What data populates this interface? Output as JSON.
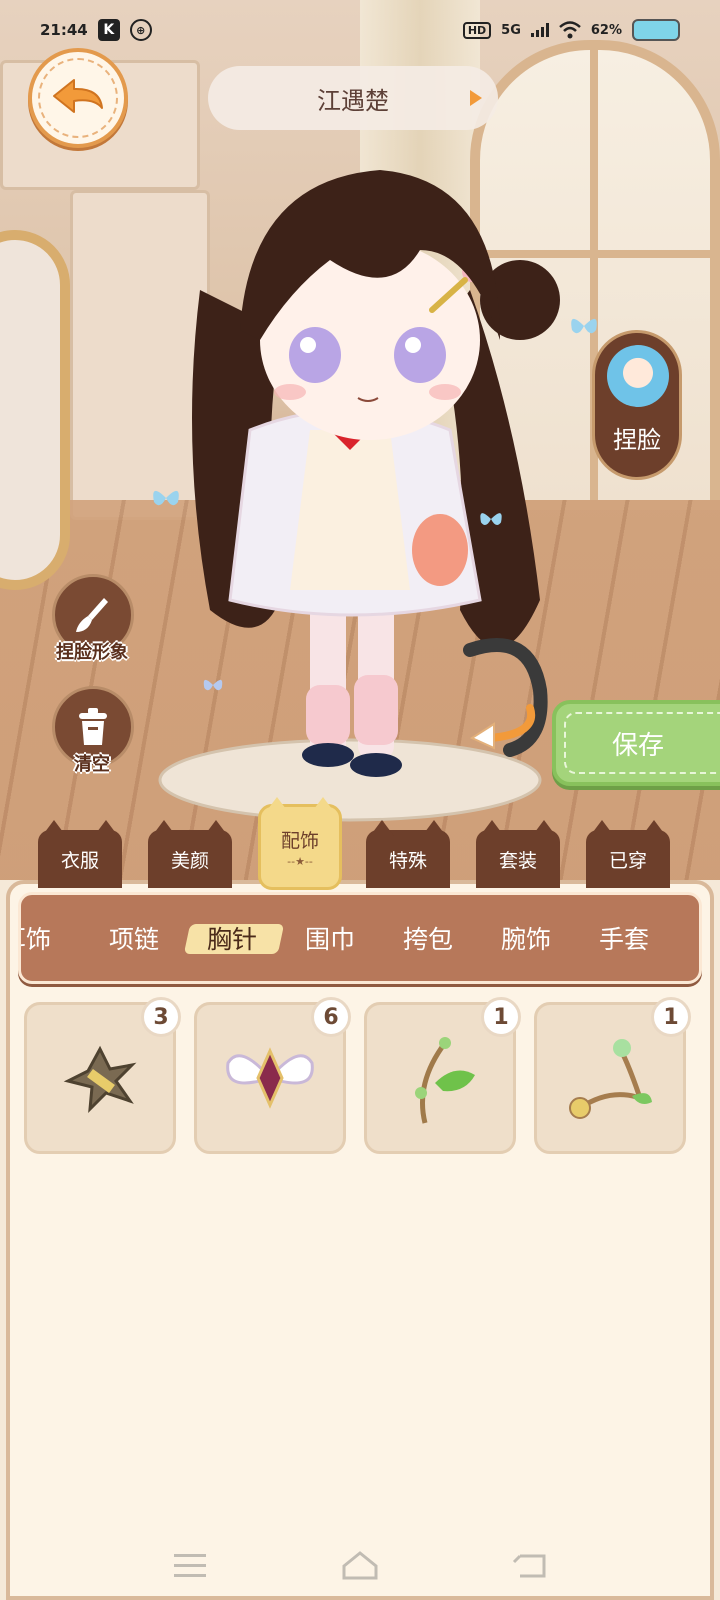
{
  "status_bar": {
    "time": "21:44",
    "k_icon": "K",
    "network": "5G",
    "hd": "HD",
    "battery": "62%"
  },
  "header": {
    "character_name": "江遇楚"
  },
  "side_buttons": {
    "face_edit": "捏脸",
    "face_image": "捏脸形象",
    "clear": "清空",
    "save": "保存"
  },
  "category_tabs": [
    {
      "label": "衣服",
      "active": false
    },
    {
      "label": "美颜",
      "active": false
    },
    {
      "label": "配饰",
      "active": true
    },
    {
      "label": "特殊",
      "active": false
    },
    {
      "label": "套装",
      "active": false
    },
    {
      "label": "已穿",
      "active": false
    }
  ],
  "sub_tabs": [
    {
      "label": "耳饰",
      "active": false
    },
    {
      "label": "项链",
      "active": false
    },
    {
      "label": "胸针",
      "active": true
    },
    {
      "label": "围巾",
      "active": false
    },
    {
      "label": "挎包",
      "active": false
    },
    {
      "label": "腕饰",
      "active": false
    },
    {
      "label": "手套",
      "active": false
    }
  ],
  "items": [
    {
      "icon": "star-badge-brooch-icon",
      "count": "3"
    },
    {
      "icon": "bow-gem-brooch-icon",
      "count": "6"
    },
    {
      "icon": "green-bird-branch-brooch-icon",
      "count": "1"
    },
    {
      "icon": "flower-vine-brooch-icon",
      "count": "1"
    }
  ],
  "colors": {
    "brown": "#6d3f2b",
    "save_green": "#a4d47b",
    "active_tab_yellow": "#f4d98a",
    "panel_bg": "#fdf4e6"
  }
}
